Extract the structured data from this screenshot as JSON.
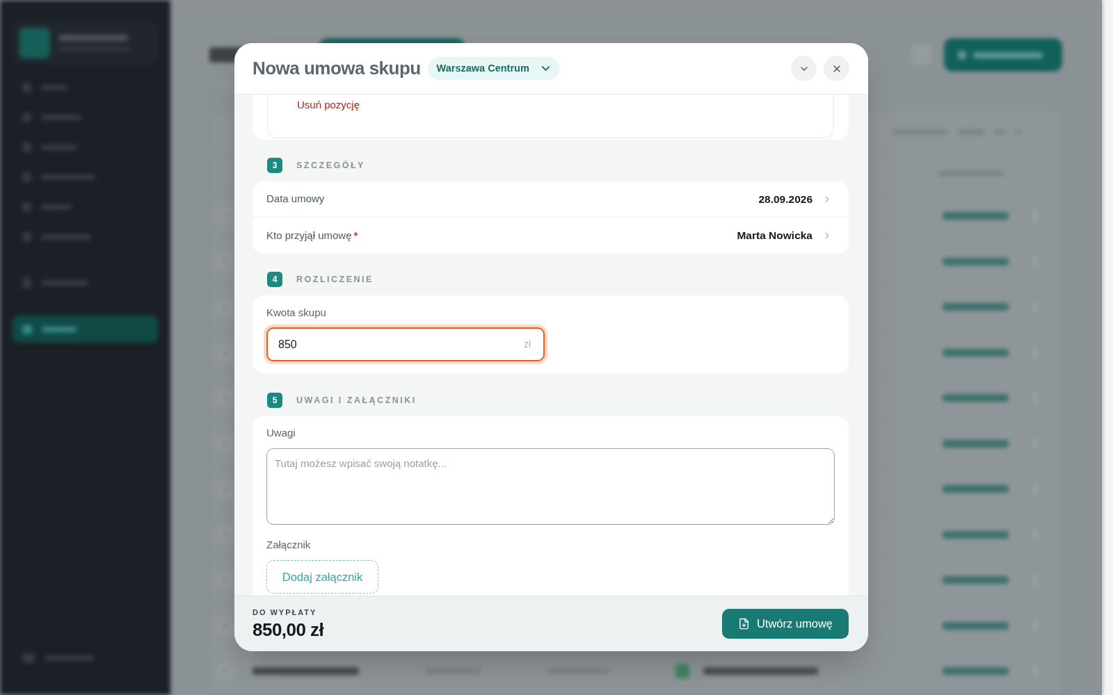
{
  "dialog": {
    "title": "Nowa umowa skupu",
    "location": {
      "label": "Warszawa Centrum"
    }
  },
  "item": {
    "remove_link": "Usuń pozycję"
  },
  "sections": [
    {
      "kind": "details",
      "number": "3",
      "title": "SZCZEGÓŁY",
      "rows": [
        {
          "label": "Data umowy",
          "value": "28.09.2026"
        },
        {
          "label": "Kto przyjął umowę",
          "required_mark": "*",
          "value": "Marta Nowicka"
        }
      ]
    },
    {
      "kind": "settlement",
      "number": "4",
      "title": "ROZLICZENIE",
      "field": {
        "label": "Kwota skupu",
        "value": "850",
        "suffix": "zł",
        "focused": true
      }
    },
    {
      "kind": "notes",
      "number": "5",
      "title": "UWAGI I ZAŁĄCZNIKI",
      "notes": {
        "label": "Uwagi",
        "placeholder": "Tutaj możesz wpisać swoją notatkę..."
      },
      "attachment": {
        "label": "Załącznik",
        "button": "Dodaj załącznik"
      }
    }
  ],
  "footer": {
    "total_label": "DO WYPŁATY",
    "total": "850,00 zł",
    "submit": "Utwórz umowę"
  }
}
